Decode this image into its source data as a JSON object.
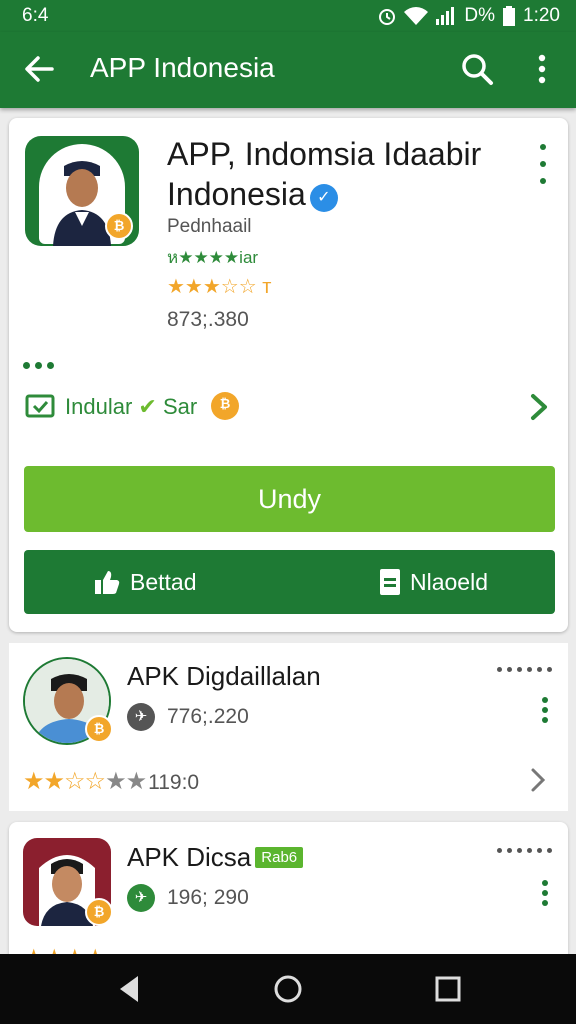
{
  "status": {
    "time": "6:4",
    "battery": "D%",
    "clock": "1:20"
  },
  "appbar": {
    "title": "APP Indonesia"
  },
  "featured": {
    "title": "APP, Indomsia Idaabir Indonesia",
    "developer": "Pednhaail",
    "subtitle": "ห★★★★iar",
    "stars_text": "★★★☆☆ т",
    "count": "873;.380",
    "link_label": "Indular",
    "link_sub": "Sar",
    "coin_glyph": "₿",
    "primary_button": "Undy",
    "left_button": "Bettad",
    "right_button": "Nlaoeld",
    "verified_glyph": "✓"
  },
  "list": [
    {
      "title": "APK Digdaillalan",
      "meta": "776;.220",
      "rating_text": "119:0",
      "meta_color": "#555555"
    },
    {
      "title": "APK Dicsa",
      "tag": "Rab6",
      "meta": "196; 290",
      "meta_color": "#2e8b3a"
    }
  ],
  "colors": {
    "brand": "#1e7a34",
    "accent": "#6dbb2f",
    "star": "#f2a62a"
  }
}
